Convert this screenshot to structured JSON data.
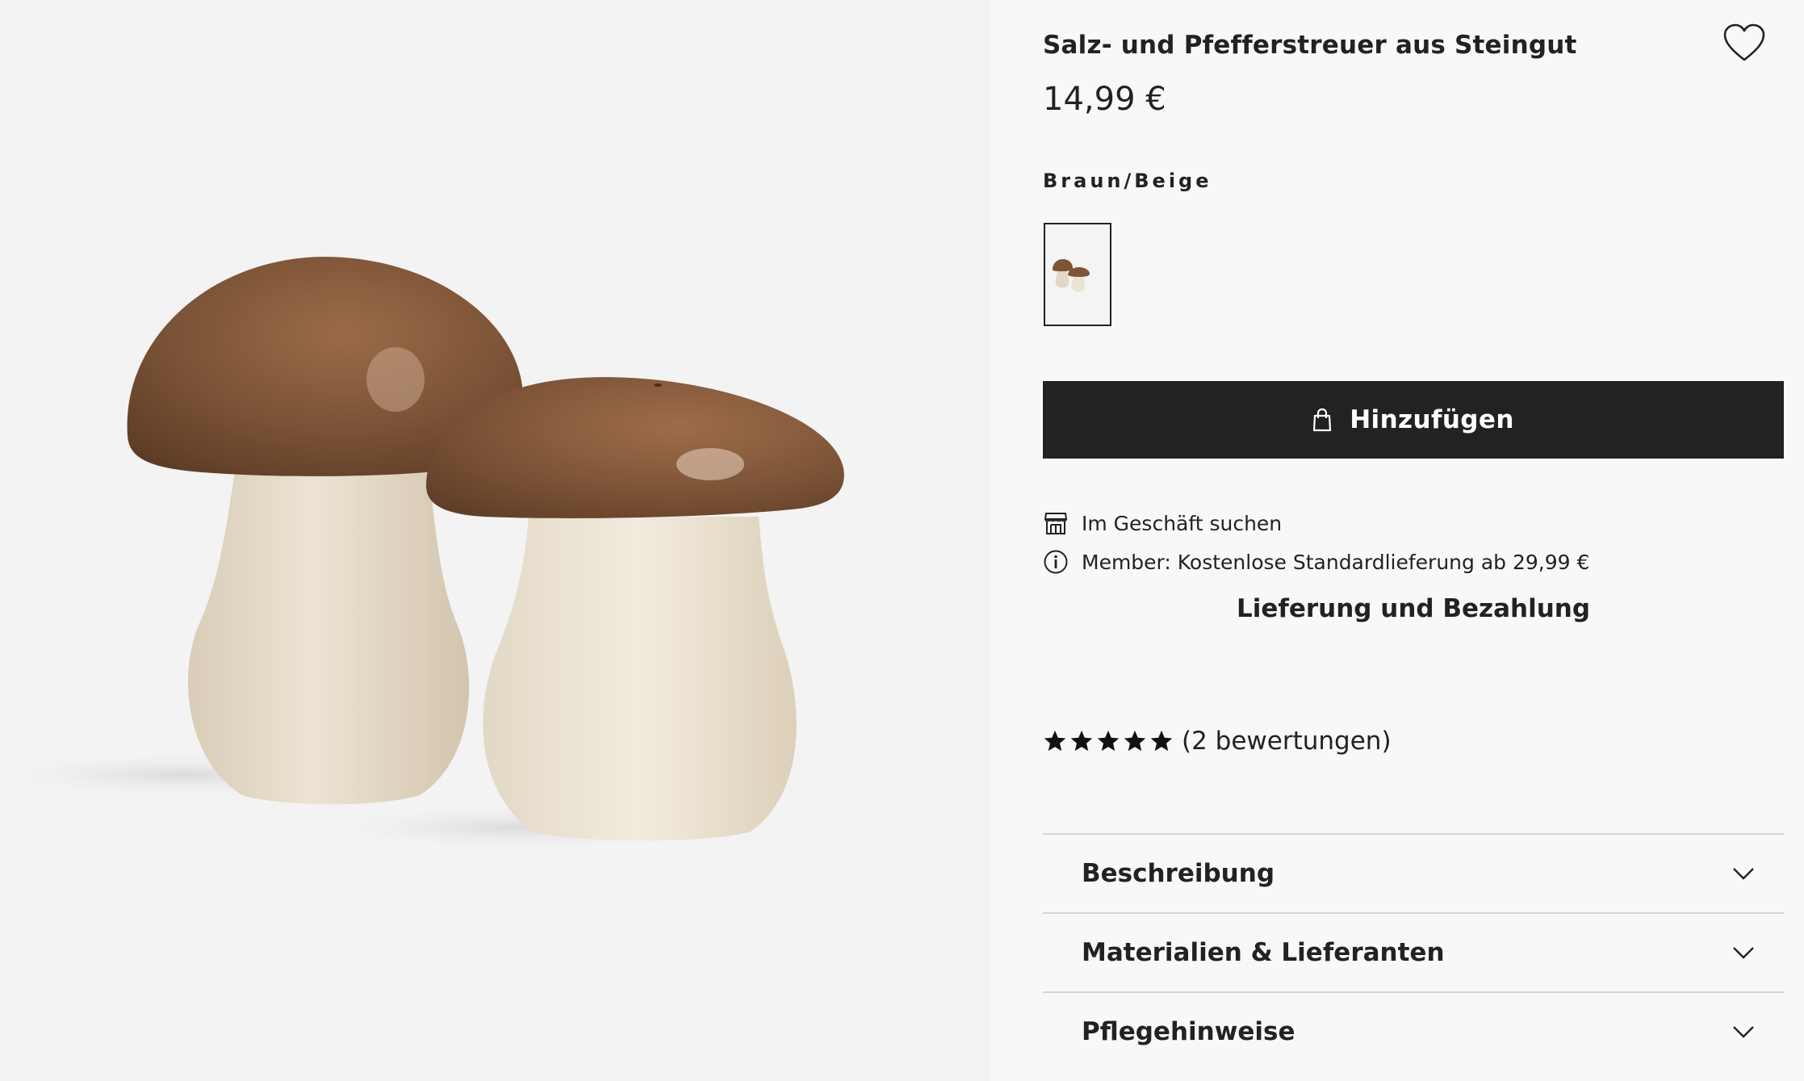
{
  "product": {
    "title": "Salz- und Pfefferstreuer aus Steingut",
    "price": "14,99 €",
    "color_name": "Braun/Beige",
    "image_alt_icon": "product-mushroom-shakers-image"
  },
  "actions": {
    "add_to_cart_label": "Hinzufügen",
    "favorite_icon": "heart-icon",
    "bag_icon": "shopping-bag-icon"
  },
  "info": {
    "store_search_label": "Im Geschäft suchen",
    "store_icon": "store-icon",
    "member_label": "Member: Kostenlose Standardlieferung ab 29,99 €",
    "member_icon": "info-icon",
    "delivery_link": "Lieferung und Bezahlung"
  },
  "rating": {
    "stars": 5,
    "max": 5,
    "count_label": "(2 bewertungen)"
  },
  "accordion": [
    {
      "label": "Beschreibung"
    },
    {
      "label": "Materialien & Lieferanten"
    },
    {
      "label": "Pflegehinweise"
    }
  ],
  "colors": {
    "button_bg": "#222222",
    "page_bg": "#f8f8f8",
    "image_bg": "#f3f3f3",
    "cap_brown": "#7d5437",
    "stem_beige": "#e6dccb"
  }
}
